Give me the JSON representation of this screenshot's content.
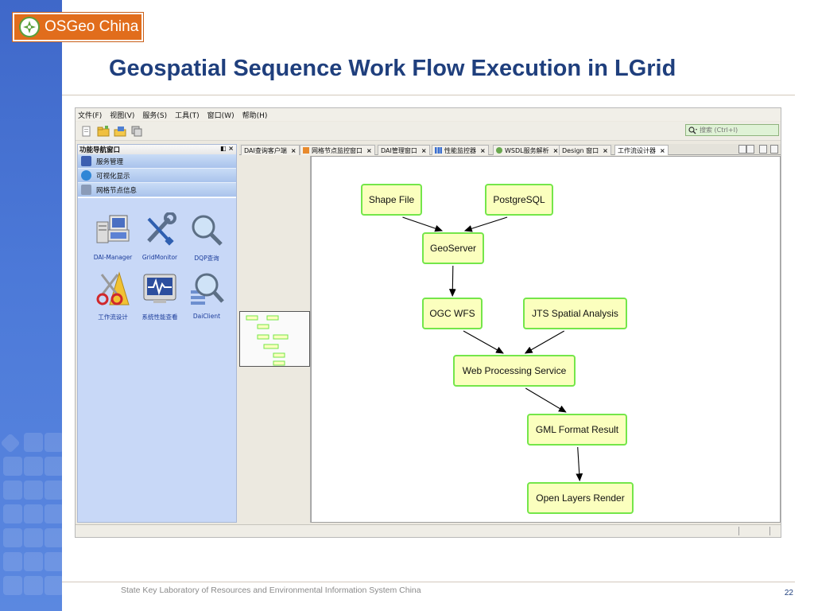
{
  "logo": {
    "text": "OSGeo China"
  },
  "slide": {
    "title": "Geospatial Sequence Work Flow Execution in LGrid",
    "footer": "State Key Laboratory of Resources and Environmental Information System China",
    "page_number": "22"
  },
  "menu": [
    "文件(F)",
    "视图(V)",
    "服务(S)",
    "工具(T)",
    "窗口(W)",
    "帮助(H)"
  ],
  "search": {
    "placeholder": "搜索 (Ctrl+I)"
  },
  "nav": {
    "title": "功能导航窗口",
    "header_controls": "◧ ×",
    "sections": [
      "服务管理",
      "可视化显示",
      "网格节点信息"
    ],
    "apps": [
      "DAI-Manager",
      "GridMonitor",
      "DQP查询",
      "工作流设计",
      "系统性能查看",
      "DaiClient"
    ]
  },
  "tabs": [
    {
      "label": "DAI查询客户端",
      "active": false
    },
    {
      "label": "网格节点监控窗口",
      "active": false
    },
    {
      "label": "DAI管理窗口",
      "active": false
    },
    {
      "label": "性能监控器",
      "active": false
    },
    {
      "label": "WSDL服务解析",
      "active": false
    },
    {
      "label": "Design 窗口",
      "active": false
    },
    {
      "label": "工作流设计器",
      "active": true
    }
  ],
  "workflow": {
    "nodes": {
      "shapefile": "Shape File",
      "postgresql": "PostgreSQL",
      "geoserver": "GeoServer",
      "ogcwfs": "OGC WFS",
      "jts": "JTS Spatial Analysis",
      "wps": "Web Processing Service",
      "gml": "GML Format Result",
      "openlayers": "Open Layers Render"
    },
    "edges": [
      [
        "shapefile",
        "geoserver"
      ],
      [
        "postgresql",
        "geoserver"
      ],
      [
        "geoserver",
        "ogcwfs"
      ],
      [
        "ogcwfs",
        "wps"
      ],
      [
        "jts",
        "wps"
      ],
      [
        "wps",
        "gml"
      ],
      [
        "gml",
        "openlayers"
      ]
    ]
  },
  "colors": {
    "node_fill": "#fbffbe",
    "node_border": "#74e64a",
    "title": "#1f3f7d",
    "logo_bg": "#e16d1c"
  }
}
